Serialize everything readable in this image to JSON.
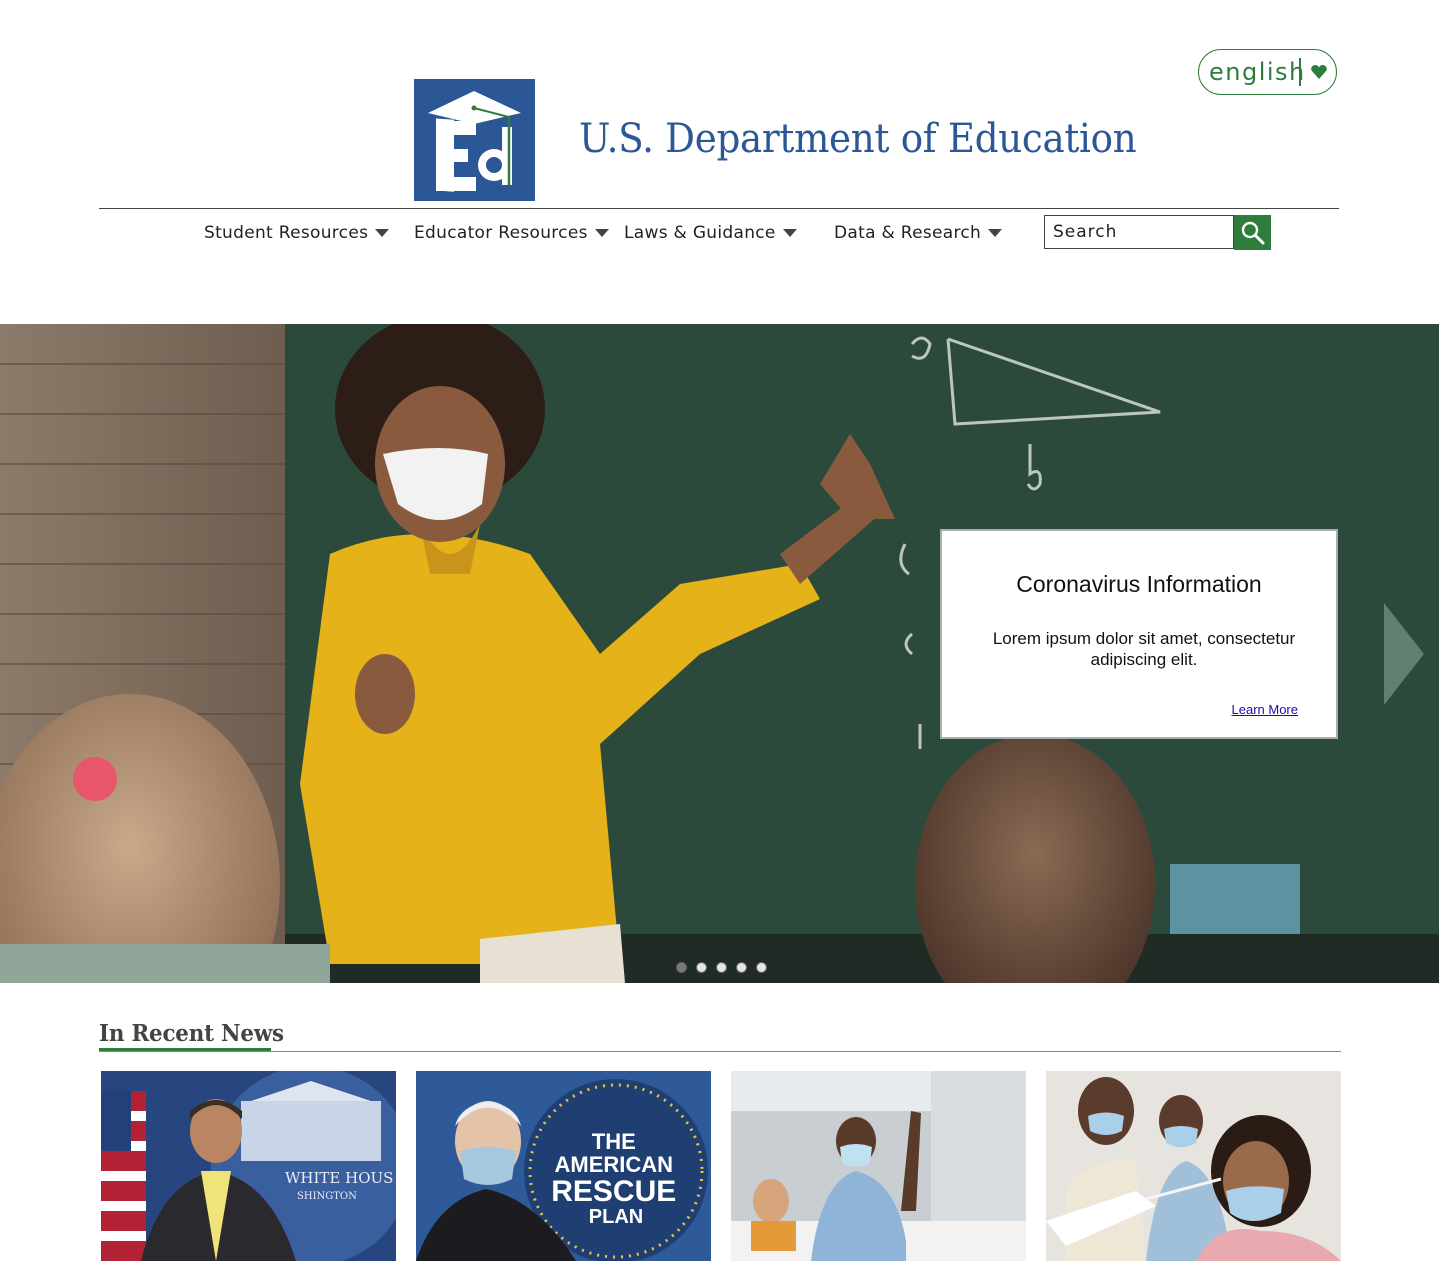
{
  "header": {
    "language": "english",
    "site_title": "U.S. Department of Education"
  },
  "nav": {
    "items": [
      {
        "label": "Student Resources"
      },
      {
        "label": "Educator Resources"
      },
      {
        "label": "Laws & Guidance"
      },
      {
        "label": "Data & Research"
      }
    ],
    "search_placeholder": "Search"
  },
  "hero": {
    "card_title": "Coronavirus Information",
    "card_body": "Lorem ipsum dolor sit amet, consectetur adipiscing elit.",
    "card_link": "Learn More",
    "slide_count": 5,
    "active_slide": 1
  },
  "news": {
    "heading": "In Recent News",
    "cards": [
      {
        "label": "WHITE HOUS",
        "sublabel": "SHINGTON"
      },
      {
        "label": "THE AMERICAN RESCUE PLAN"
      },
      {
        "label": ""
      },
      {
        "label": ""
      }
    ],
    "card2_lines": [
      "THE",
      "AMERICAN",
      "RESCUE",
      "PLAN"
    ]
  },
  "colors": {
    "brand_blue": "#2b5796",
    "brand_green": "#2e7d3c"
  }
}
